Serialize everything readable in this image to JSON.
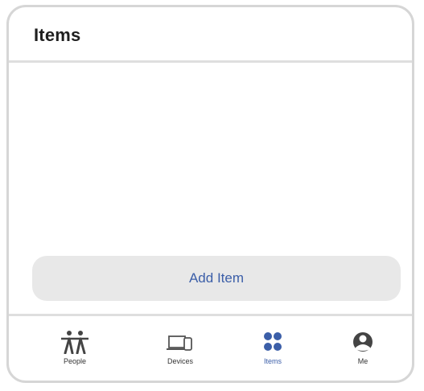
{
  "header": {
    "title": "Items"
  },
  "main": {
    "add_button_label": "Add Item"
  },
  "tabs": [
    {
      "label": "People",
      "icon": "people-icon",
      "active": false
    },
    {
      "label": "Devices",
      "icon": "devices-icon",
      "active": false
    },
    {
      "label": "Items",
      "icon": "items-icon",
      "active": true
    },
    {
      "label": "Me",
      "icon": "me-icon",
      "active": false
    }
  ],
  "colors": {
    "accent": "#3b5ea8",
    "button_bg": "#e8e8e8",
    "divider": "#dedede"
  }
}
